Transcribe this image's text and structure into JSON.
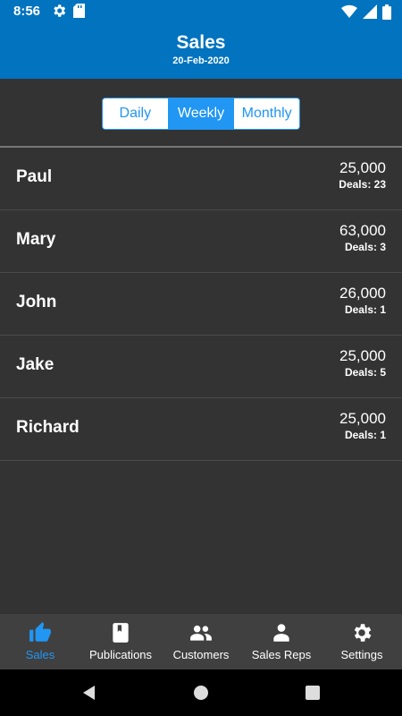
{
  "status_bar": {
    "time": "8:56",
    "icons": [
      "gear-icon",
      "sd-card-icon",
      "wifi-icon",
      "signal-icon",
      "battery-icon"
    ]
  },
  "app_bar": {
    "title": "Sales",
    "subtitle": "20-Feb-2020"
  },
  "period_selector": {
    "options": [
      "Daily",
      "Weekly",
      "Monthly"
    ],
    "selected": "Weekly"
  },
  "reps": [
    {
      "name": "Paul",
      "amount": "25,000",
      "deals": "Deals: 23"
    },
    {
      "name": "Mary",
      "amount": "63,000",
      "deals": "Deals: 3"
    },
    {
      "name": "John",
      "amount": "26,000",
      "deals": "Deals: 1"
    },
    {
      "name": "Jake",
      "amount": "25,000",
      "deals": "Deals: 5"
    },
    {
      "name": "Richard",
      "amount": "25,000",
      "deals": "Deals: 1"
    }
  ],
  "tabs": [
    {
      "label": "Sales",
      "icon": "thumbs-up-icon",
      "active": true
    },
    {
      "label": "Publications",
      "icon": "book-icon",
      "active": false
    },
    {
      "label": "Customers",
      "icon": "people-icon",
      "active": false
    },
    {
      "label": "Sales Reps",
      "icon": "person-icon",
      "active": false
    },
    {
      "label": "Settings",
      "icon": "gear-icon",
      "active": false
    }
  ],
  "colors": {
    "primary": "#0173bf",
    "accent": "#2196f3",
    "background": "#333333",
    "tab_bar": "#404040"
  }
}
